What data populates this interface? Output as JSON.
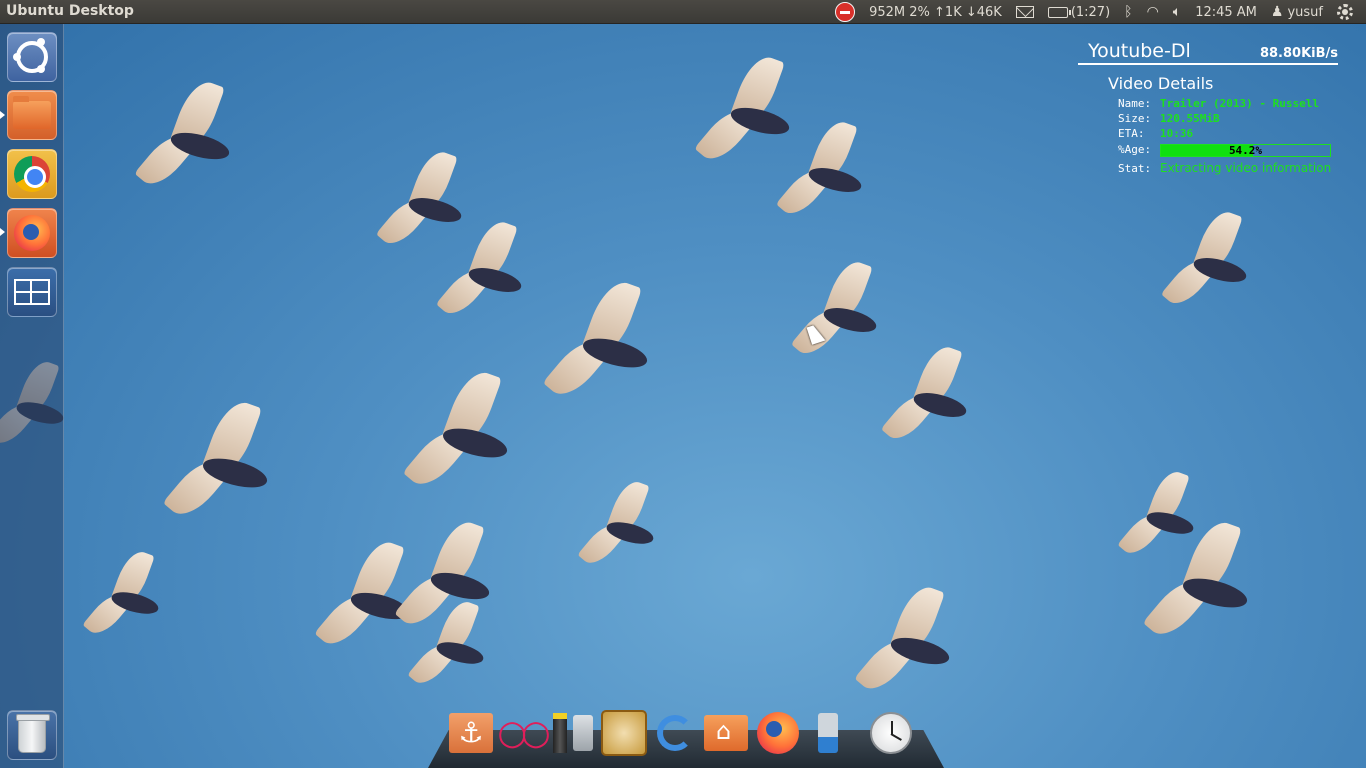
{
  "panel": {
    "title": "Ubuntu Desktop",
    "sysmon": "952M 2% ↑1K ↓46K",
    "battery": "(1:27)",
    "clock": "12:45 AM",
    "user": "yusuf"
  },
  "launcher": {
    "items": [
      "Dash",
      "Files",
      "Google Chrome",
      "Firefox",
      "Workspace Switcher",
      "Trash"
    ]
  },
  "conky": {
    "title": "Youtube-Dl",
    "speed": "88.80KiB/s",
    "subtitle": "Video Details",
    "name_key": "Name:",
    "name_val": "Trailer (2013) - Russell",
    "size_key": "Size:",
    "size_val": "120.55MiB",
    "eta_key": "ETA:",
    "eta_val": "10:36",
    "pct_key": "%Age:",
    "pct_val": "54.2%",
    "pct_fraction": 0.542,
    "stat_key": "Stat:",
    "stat_val": "Extracting video information",
    "accent_color": "#1ee01e"
  },
  "dock": {
    "items": [
      "anchor-icon",
      "rings-icon",
      "battery-icon",
      "plug-icon",
      "quran-icon",
      "reload-icon",
      "home-folder-icon",
      "firefox-icon",
      "lamp-icon",
      "clock-icon"
    ]
  }
}
